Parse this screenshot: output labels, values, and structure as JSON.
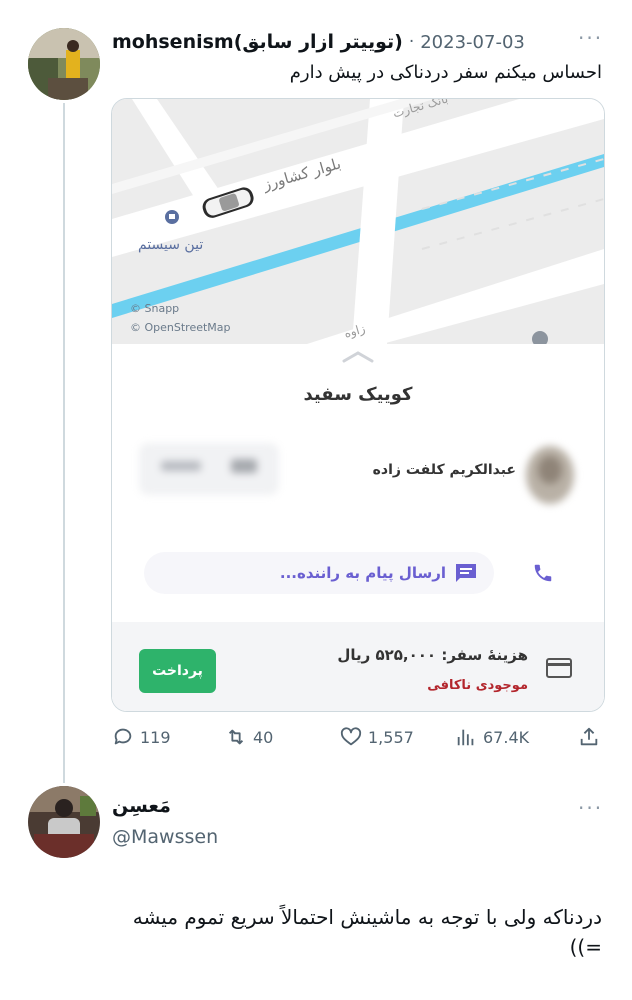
{
  "tweet": {
    "author_name": "mohsenism(تویيتر ازار سابق)",
    "separator": "·",
    "date": "2023-07-03",
    "more": "···",
    "text": "احساس میکنم سفر دردناکی در پیش  دارم",
    "actions": {
      "replies": "119",
      "retweets": "40",
      "likes": "1,557",
      "views": "67.4K"
    }
  },
  "snapp": {
    "map": {
      "street_top": "بانک تجارت",
      "boulevard": "بلوار کشاورز",
      "poi": "تین سیستم",
      "attribution_1": "© Snapp",
      "attribution_2": "© OpenStreetMap",
      "street_bottom": "زاوه"
    },
    "car_name": "کوییک سفید",
    "driver_name": "عبدالکریم کلفت زاده",
    "message_placeholder": "ارسال پیام به راننده...",
    "fare_text": "هزینهٔ سفر: ۵۲۵,۰۰۰ ریال",
    "balance_warning": "موجودی ناکافی",
    "pay_button": "پرداخت",
    "colors": {
      "green": "#2eb36b",
      "purple": "#6a5fd1",
      "road_blue": "#6cd0f0",
      "warning_red": "#b3262d"
    }
  },
  "reply": {
    "author_name": "مَعسِن",
    "handle": "@Mawssen",
    "more": "···",
    "text_line1": "دردناکه ولی با توجه به ماشینش احتمالاً سریع تموم میشه",
    "text_line2": "=))"
  }
}
